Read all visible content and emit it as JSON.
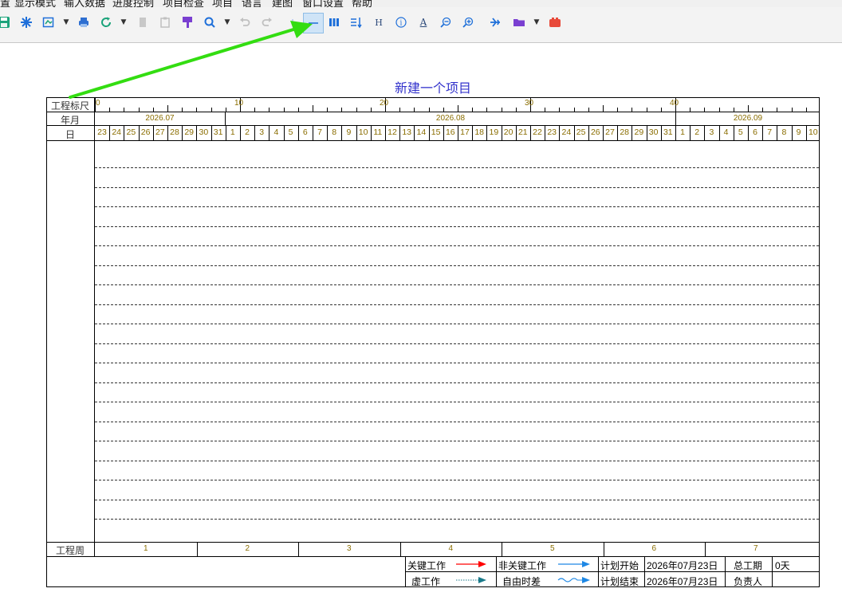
{
  "menu": {
    "items": [
      "置",
      "显示模式",
      "输入数据",
      "进度控制",
      "项目检查",
      "项目",
      "语言",
      "建图",
      "窗口设置",
      "帮助"
    ]
  },
  "toolbar": {
    "icons": [
      "save-icon",
      "asterisk-icon",
      "export-icon",
      "print-icon",
      "refresh-icon",
      "copy-icon",
      "paste-icon",
      "format-brush-icon",
      "zoom-icon",
      "undo-icon",
      "redo-icon",
      "vertical-line-icon",
      "horizontal-line-icon",
      "columns-icon",
      "sort-icon",
      "h-icon",
      "info-icon",
      "text-icon",
      "zoom-out-icon",
      "zoom-in-icon",
      "airplane-icon",
      "folder-icon",
      "red-box-icon"
    ],
    "active": "horizontal-line-icon",
    "h_glyph": "H",
    "text_glyph": "A",
    "info_glyph": "i"
  },
  "project": {
    "title": "新建一个项目"
  },
  "header": {
    "ruler_label": "工程标尺",
    "ruler_ticks": [
      "0",
      "10",
      "20",
      "30",
      "40"
    ],
    "month_label": "年月",
    "months": [
      "2026.07",
      "2026.08",
      "2026.09"
    ],
    "day_label": "日",
    "days": [
      "23",
      "24",
      "25",
      "26",
      "27",
      "28",
      "29",
      "30",
      "31",
      "1",
      "2",
      "3",
      "4",
      "5",
      "6",
      "7",
      "8",
      "9",
      "10",
      "11",
      "12",
      "13",
      "14",
      "15",
      "16",
      "17",
      "18",
      "19",
      "20",
      "21",
      "22",
      "23",
      "24",
      "25",
      "26",
      "27",
      "28",
      "29",
      "30",
      "31",
      "1",
      "2",
      "3",
      "4",
      "5",
      "6",
      "7",
      "8",
      "9",
      "10"
    ]
  },
  "footer": {
    "week_label": "工程周",
    "weeks": [
      "1",
      "2",
      "3",
      "4",
      "5",
      "6",
      "7"
    ]
  },
  "legend": {
    "critical": "关键工作",
    "noncritical": "非关键工作",
    "dummy": "虚工作",
    "float": "自由时差",
    "plan_start_label": "计划开始",
    "plan_start": "2026年07月23日",
    "plan_end_label": "计划结束",
    "plan_end": "2026年07月23日",
    "duration_label": "总工期",
    "duration": "0天",
    "owner_label": "负责人",
    "owner": "",
    "colors": {
      "critical": "#ff0000",
      "noncritical": "#1e88e5",
      "dummy": "#1a7a8a",
      "float": "#1e88e5"
    }
  },
  "annotation": {
    "color": "#33dd11"
  }
}
